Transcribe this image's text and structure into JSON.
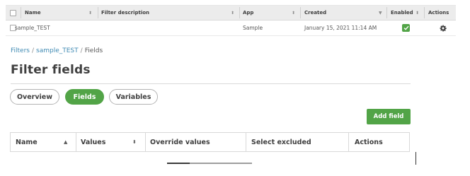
{
  "filters_table": {
    "columns": [
      "Name",
      "Filter description",
      "App",
      "Created",
      "Enabled",
      "Actions"
    ],
    "rows": [
      {
        "name": "sample_TEST",
        "filter_description": "",
        "app": "Sample",
        "created": "January 15, 2021 11:14 AM",
        "enabled": true,
        "actions_icon": "gear-icon"
      }
    ]
  },
  "breadcrumb": {
    "items": [
      "Filters",
      "sample_TEST",
      "Fields"
    ],
    "separator": "/"
  },
  "page_title": "Filter fields",
  "tabs": [
    {
      "label": "Overview",
      "active": false
    },
    {
      "label": "Fields",
      "active": true
    },
    {
      "label": "Variables",
      "active": false
    }
  ],
  "add_field_button": "Add field",
  "fields_table": {
    "columns": [
      "Name",
      "Values",
      "Override values",
      "Select excluded",
      "Actions"
    ],
    "sorted_column": "Name",
    "sort_direction": "ascending",
    "rows": []
  },
  "colors": {
    "accent_green": "#52a447",
    "link_blue": "#3f8ab3",
    "header_bg": "#ececec"
  }
}
